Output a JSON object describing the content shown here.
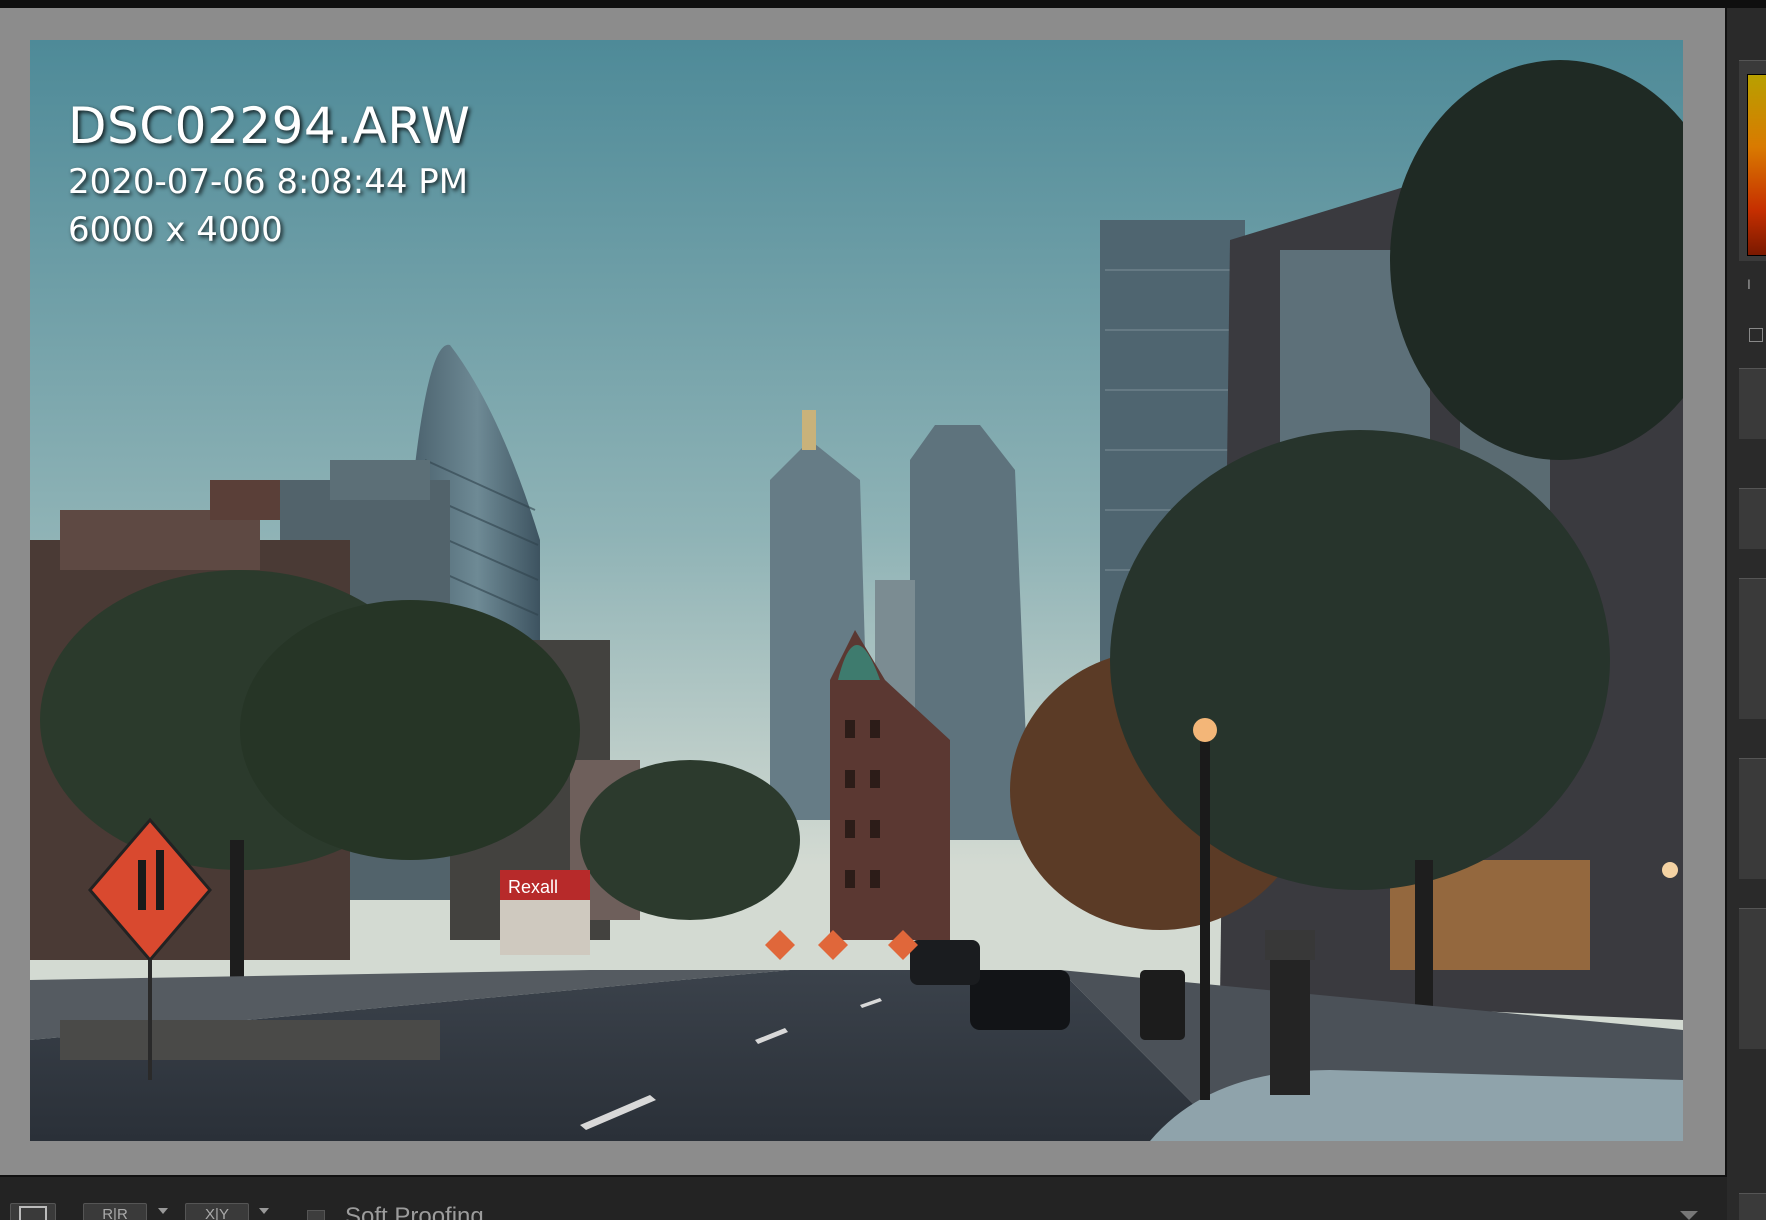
{
  "photo": {
    "filename": "DSC02294.ARW",
    "datetime": "2020-07-06 8:08:44 PM",
    "dimensions": "6000 x 4000"
  },
  "scene": {
    "storefront_sign": "Rexall"
  },
  "toolbar": {
    "view_mode_loupe_icon": "loupe-view-icon",
    "view_mode_compare_icon": "compare-view-icon",
    "view_mode_compare_label": "R|R",
    "view_mode_survey_icon": "survey-view-icon",
    "view_mode_survey_label": "X|Y",
    "soft_proofing_label": "Soft Proofing",
    "soft_proofing_checked": false
  },
  "colors": {
    "viewer_background": "#8c8c8c",
    "panel_background": "#2a2a2a",
    "overlay_text": "#ffffff"
  }
}
